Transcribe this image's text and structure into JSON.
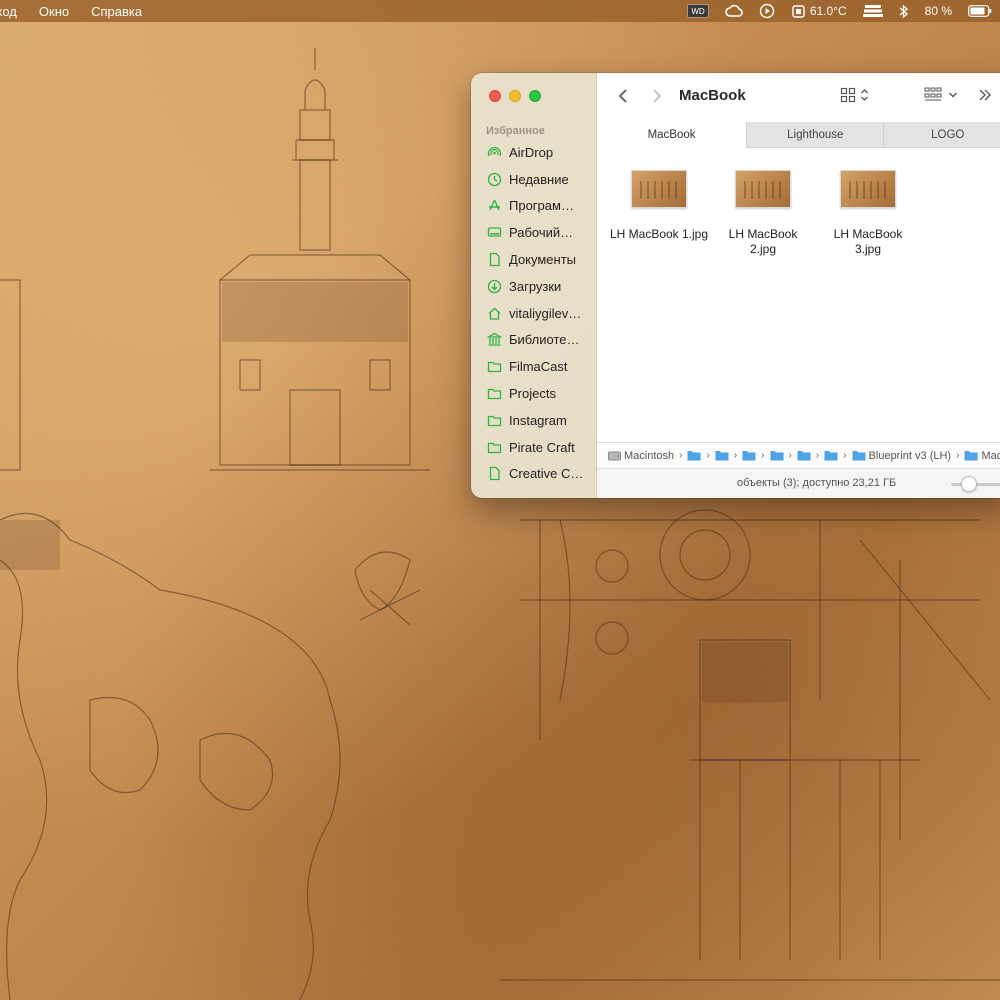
{
  "menubar": {
    "items": [
      "ход",
      "Окно",
      "Справка"
    ],
    "temperature": "61.0°C",
    "battery_percent": "80 %"
  },
  "finder": {
    "title": "MacBook",
    "sidebar": {
      "heading": "Избранное",
      "items": [
        {
          "label": "AirDrop",
          "icon": "airdrop-icon"
        },
        {
          "label": "Недавние",
          "icon": "clock-icon"
        },
        {
          "label": "Програм…",
          "icon": "applications-icon"
        },
        {
          "label": "Рабочий…",
          "icon": "desktop-icon"
        },
        {
          "label": "Документы",
          "icon": "document-icon"
        },
        {
          "label": "Загрузки",
          "icon": "download-icon"
        },
        {
          "label": "vitaliygilev…",
          "icon": "home-icon"
        },
        {
          "label": "Библиоте…",
          "icon": "library-icon"
        },
        {
          "label": "FilmaCast",
          "icon": "folder-icon"
        },
        {
          "label": "Projects",
          "icon": "folder-icon"
        },
        {
          "label": "Instagram",
          "icon": "folder-icon"
        },
        {
          "label": "Pirate Craft",
          "icon": "folder-icon"
        },
        {
          "label": "Creative C…",
          "icon": "file-icon"
        }
      ]
    },
    "tabs": [
      {
        "label": "MacBook",
        "active": true
      },
      {
        "label": "Lighthouse",
        "active": false
      },
      {
        "label": "LOGO",
        "active": false
      }
    ],
    "files": [
      {
        "line1": "LH MacBook 1.jpg",
        "line2": ""
      },
      {
        "line1": "LH MacBook",
        "line2": "2.jpg"
      },
      {
        "line1": "LH MacBook",
        "line2": "3.jpg"
      }
    ],
    "path": {
      "disk": "Macintosh",
      "folder": "Blueprint v3 (LH)",
      "last": "Mac"
    },
    "status": "объекты (3); доступно 23,21 ГБ"
  },
  "colors": {
    "accent_green": "#2fb344",
    "folder_blue": "#4da3e8"
  }
}
